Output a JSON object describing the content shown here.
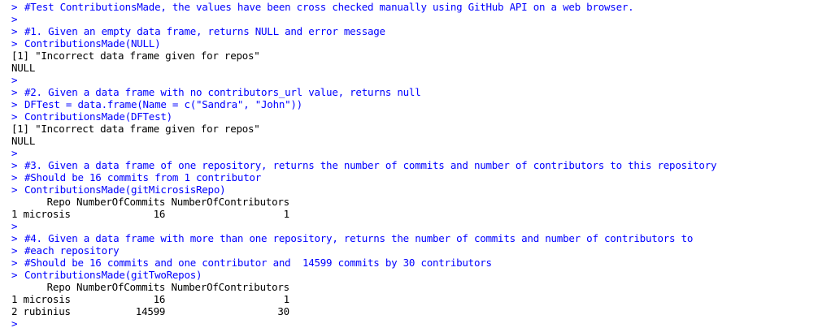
{
  "console": {
    "prompt_symbol": ">",
    "lines": [
      {
        "type": "input",
        "text": "#Test ContributionsMade, the values have been cross checked manually using GitHub API on a web browser."
      },
      {
        "type": "input",
        "text": ""
      },
      {
        "type": "input",
        "text": "#1. Given an empty data frame, returns NULL and error message"
      },
      {
        "type": "input",
        "text": "ContributionsMade(NULL)"
      },
      {
        "type": "output",
        "text": "[1] \"Incorrect data frame given for repos\""
      },
      {
        "type": "output",
        "text": "NULL"
      },
      {
        "type": "input",
        "text": ""
      },
      {
        "type": "input",
        "text": "#2. Given a data frame with no contributors_url value, returns null"
      },
      {
        "type": "input",
        "text": "DFTest = data.frame(Name = c(\"Sandra\", \"John\"))"
      },
      {
        "type": "input",
        "text": "ContributionsMade(DFTest)"
      },
      {
        "type": "output",
        "text": "[1] \"Incorrect data frame given for repos\""
      },
      {
        "type": "output",
        "text": "NULL"
      },
      {
        "type": "input",
        "text": ""
      },
      {
        "type": "input",
        "text": "#3. Given a data frame of one repository, returns the number of commits and number of contributors to this repository"
      },
      {
        "type": "input",
        "text": "#Should be 16 commits from 1 contributor"
      },
      {
        "type": "input",
        "text": "ContributionsMade(gitMicrosisRepo)"
      },
      {
        "type": "output",
        "text": "      Repo NumberOfCommits NumberOfContributors"
      },
      {
        "type": "output",
        "text": "1 microsis              16                    1"
      },
      {
        "type": "input",
        "text": ""
      },
      {
        "type": "input",
        "text": "#4. Given a data frame with more than one repository, returns the number of commits and number of contributors to"
      },
      {
        "type": "input",
        "text": "#each repository"
      },
      {
        "type": "input",
        "text": "#Should be 16 commits and one contributor and  14599 commits by 30 contributors"
      },
      {
        "type": "input",
        "text": "ContributionsMade(gitTwoRepos)"
      },
      {
        "type": "output",
        "text": "      Repo NumberOfCommits NumberOfContributors"
      },
      {
        "type": "output",
        "text": "1 microsis              16                    1"
      },
      {
        "type": "output",
        "text": "2 rubinius           14599                   30"
      },
      {
        "type": "input",
        "text": ""
      }
    ]
  },
  "colors": {
    "input": "#0000ff",
    "output": "#000000",
    "background": "#ffffff"
  }
}
